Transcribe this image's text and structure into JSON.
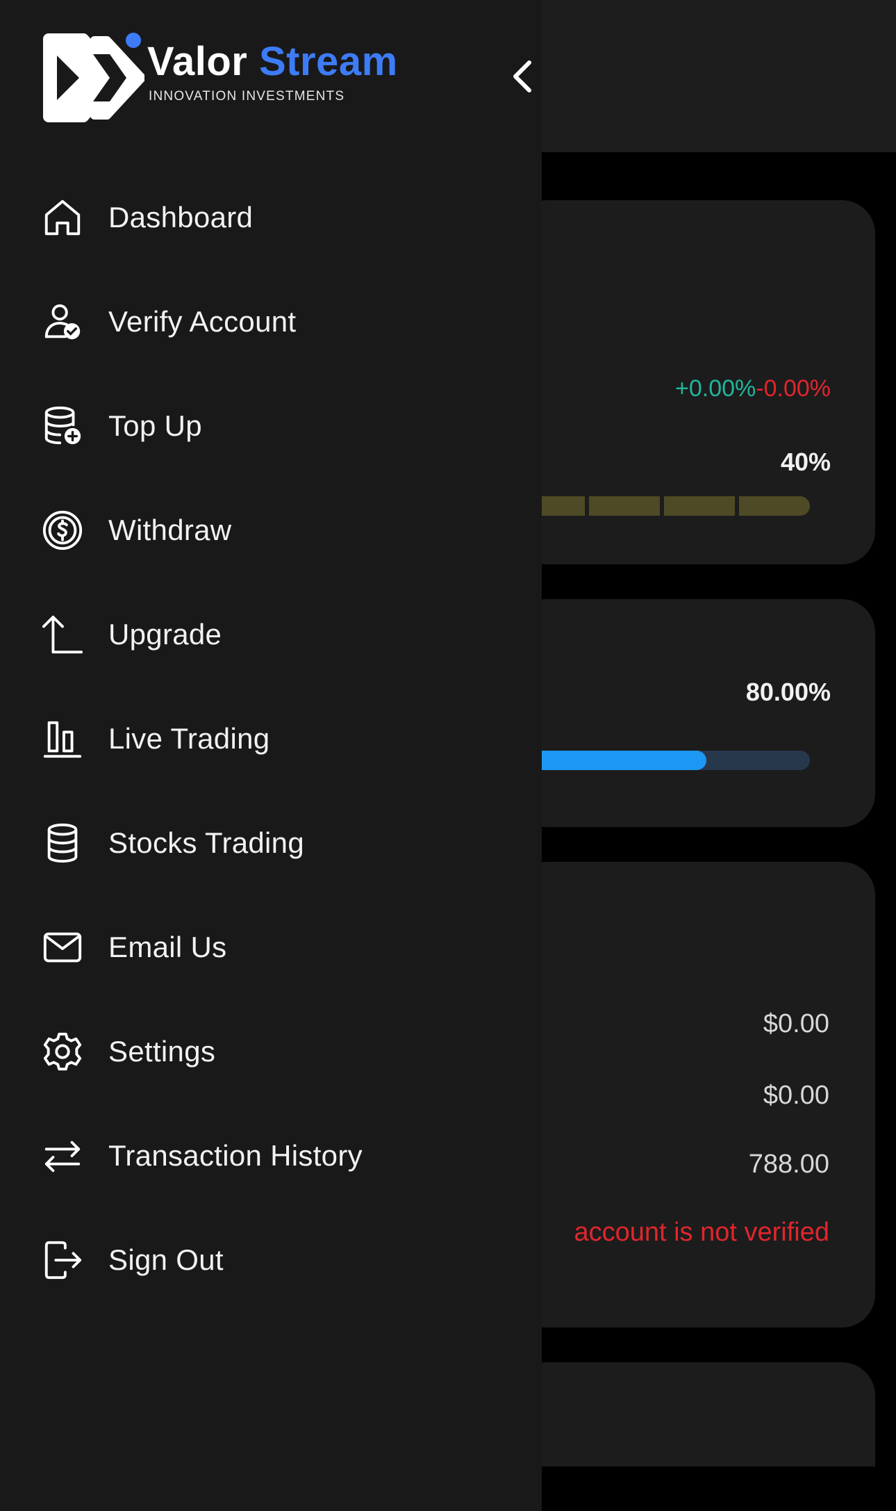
{
  "brand": {
    "name_part1": "Valor",
    "name_part2": "Stream",
    "tagline": "INNOVATION INVESTMENTS",
    "accent_color": "#3d7cf6"
  },
  "drawer": {
    "collapse_icon": "chevron-left-icon",
    "items": [
      {
        "label": "Dashboard",
        "icon": "home-icon"
      },
      {
        "label": "Verify Account",
        "icon": "user-check-icon"
      },
      {
        "label": "Top Up",
        "icon": "database-plus-icon"
      },
      {
        "label": "Withdraw",
        "icon": "dollar-circle-icon"
      },
      {
        "label": "Upgrade",
        "icon": "arrow-up-corner-icon"
      },
      {
        "label": "Live Trading",
        "icon": "bar-chart-icon"
      },
      {
        "label": "Stocks Trading",
        "icon": "database-icon"
      },
      {
        "label": "Email Us",
        "icon": "mail-icon"
      },
      {
        "label": "Settings",
        "icon": "gear-icon"
      },
      {
        "label": "Transaction History",
        "icon": "arrows-swap-icon"
      },
      {
        "label": "Sign Out",
        "icon": "logout-icon"
      }
    ]
  },
  "background": {
    "market_change": {
      "up": "+0.00%",
      "down": "-0.00%",
      "up_color": "#22b59c",
      "down_color": "#e0262b"
    },
    "risk": {
      "label": "40%",
      "segments_visible": 4,
      "segment_color": "#4e4a25"
    },
    "progress": {
      "label": "80.00%",
      "fraction": 0.8,
      "fill_color": "#1c97f3",
      "track_color": "#27384d"
    },
    "balances": {
      "value1": "$0.00",
      "value2": "$0.00",
      "value3": "788.00"
    },
    "warning": "account is not verified"
  }
}
